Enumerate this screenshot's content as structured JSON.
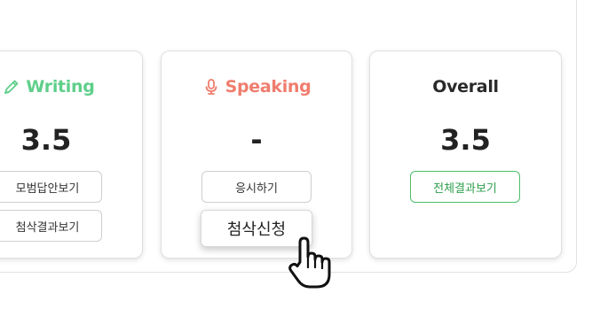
{
  "cards": {
    "writing": {
      "title": "Writing",
      "score": "3.5",
      "buttons": {
        "model_answer": "모범답안보기",
        "correction_result": "첨삭결과보기"
      },
      "accent_color": "#5fcf8a",
      "icon": "pencil-icon"
    },
    "speaking": {
      "title": "Speaking",
      "score": "-",
      "buttons": {
        "take_test": "응시하기",
        "request_correction": "첨삭신청"
      },
      "accent_color": "#ef7d6e",
      "icon": "microphone-icon"
    },
    "overall": {
      "title": "Overall",
      "score": "3.5",
      "buttons": {
        "full_result": "전체결과보기"
      },
      "accent_color": "#4cbf6a"
    }
  },
  "cursor": {
    "icon": "hand-pointer-icon"
  }
}
